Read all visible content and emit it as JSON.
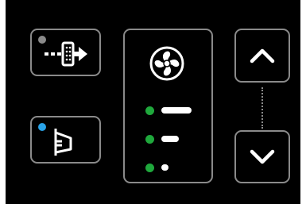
{
  "controls": {
    "air_intake_button": {
      "icon": "air-intake-icon",
      "indicator_color": "#8a8a8a",
      "indicator_state": "off"
    },
    "windshield_defrost_button": {
      "icon": "windshield-defrost-icon",
      "indicator_color": "#29a3e8",
      "indicator_state": "on"
    },
    "fan_speed": {
      "icon": "fan-icon",
      "levels": [
        {
          "level": 3,
          "active": true,
          "color": "#1fa83c"
        },
        {
          "level": 2,
          "active": true,
          "color": "#1fa83c"
        },
        {
          "level": 1,
          "active": true,
          "color": "#1fa83c"
        }
      ]
    },
    "increase_button": {
      "icon": "chevron-up-icon"
    },
    "decrease_button": {
      "icon": "chevron-down-icon"
    }
  },
  "colors": {
    "background": "#000000",
    "border": "#8a8a8a",
    "foreground": "#ffffff",
    "level_active": "#1fa83c",
    "indicator_on": "#29a3e8",
    "indicator_off": "#8a8a8a"
  }
}
